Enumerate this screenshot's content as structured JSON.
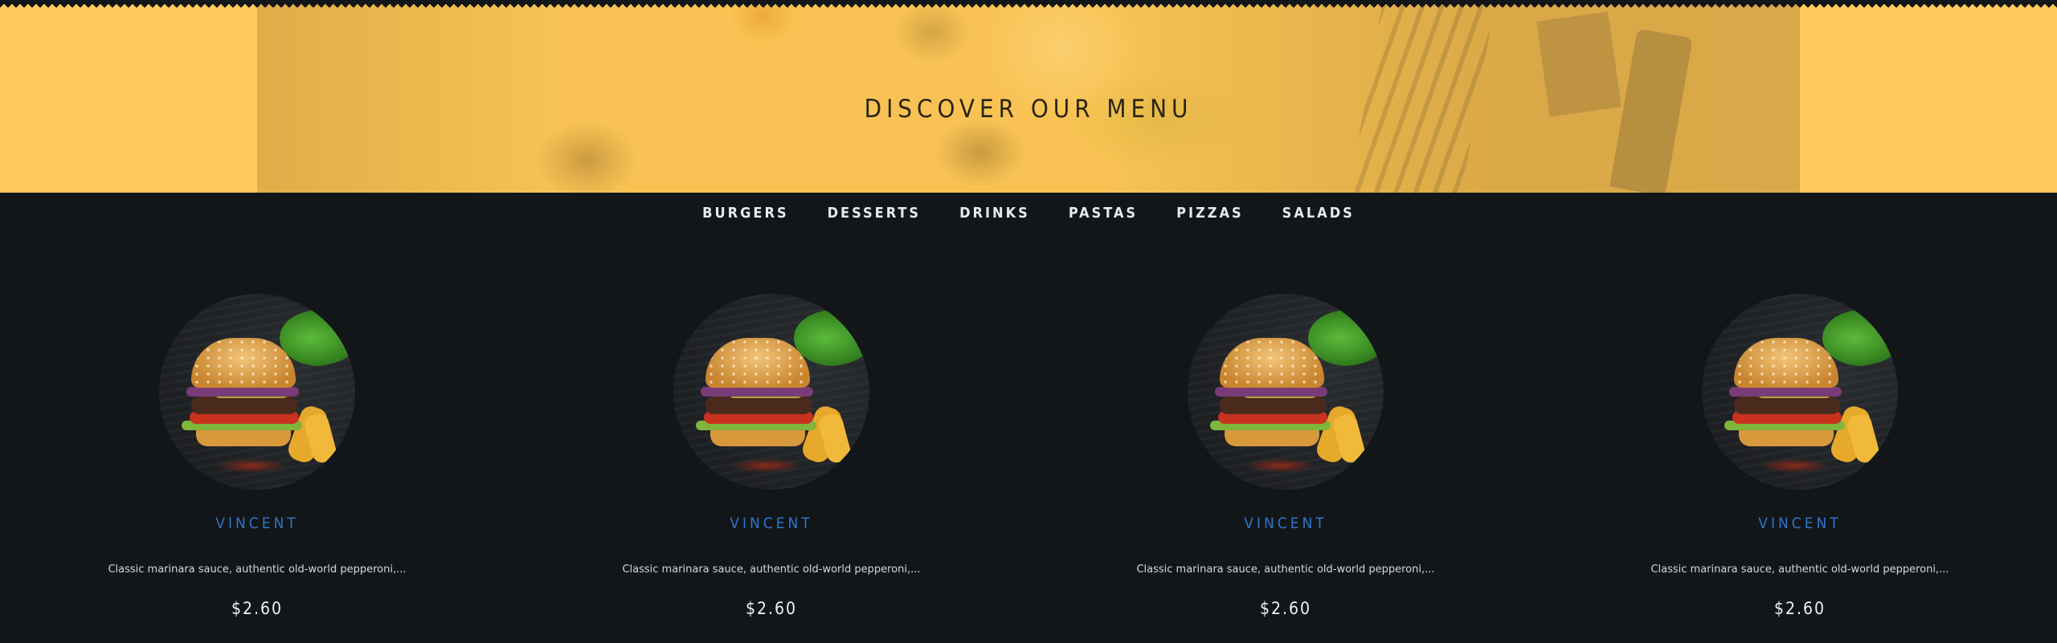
{
  "hero": {
    "title": "DISCOVER OUR MENU"
  },
  "nav": {
    "items": [
      {
        "label": "BURGERS"
      },
      {
        "label": "DESSERTS"
      },
      {
        "label": "DRINKS"
      },
      {
        "label": "PASTAS"
      },
      {
        "label": "PIZZAS"
      },
      {
        "label": "SALADS"
      }
    ]
  },
  "menu": {
    "items": [
      {
        "name": "VINCENT",
        "description": "Classic marinara sauce, authentic old-world pepperoni,...",
        "price": "$2.60",
        "image_icon": "burger-photo"
      },
      {
        "name": "VINCENT",
        "description": "Classic marinara sauce, authentic old-world pepperoni,...",
        "price": "$2.60",
        "image_icon": "burger-photo"
      },
      {
        "name": "VINCENT",
        "description": "Classic marinara sauce, authentic old-world pepperoni,...",
        "price": "$2.60",
        "image_icon": "burger-photo"
      },
      {
        "name": "VINCENT",
        "description": "Classic marinara sauce, authentic old-world pepperoni,...",
        "price": "$2.60",
        "image_icon": "burger-photo"
      }
    ]
  },
  "colors": {
    "hero_bg": "#ffc95c",
    "page_bg": "#121619",
    "item_name": "#2f74c8",
    "text_light": "#e6eaf0"
  }
}
